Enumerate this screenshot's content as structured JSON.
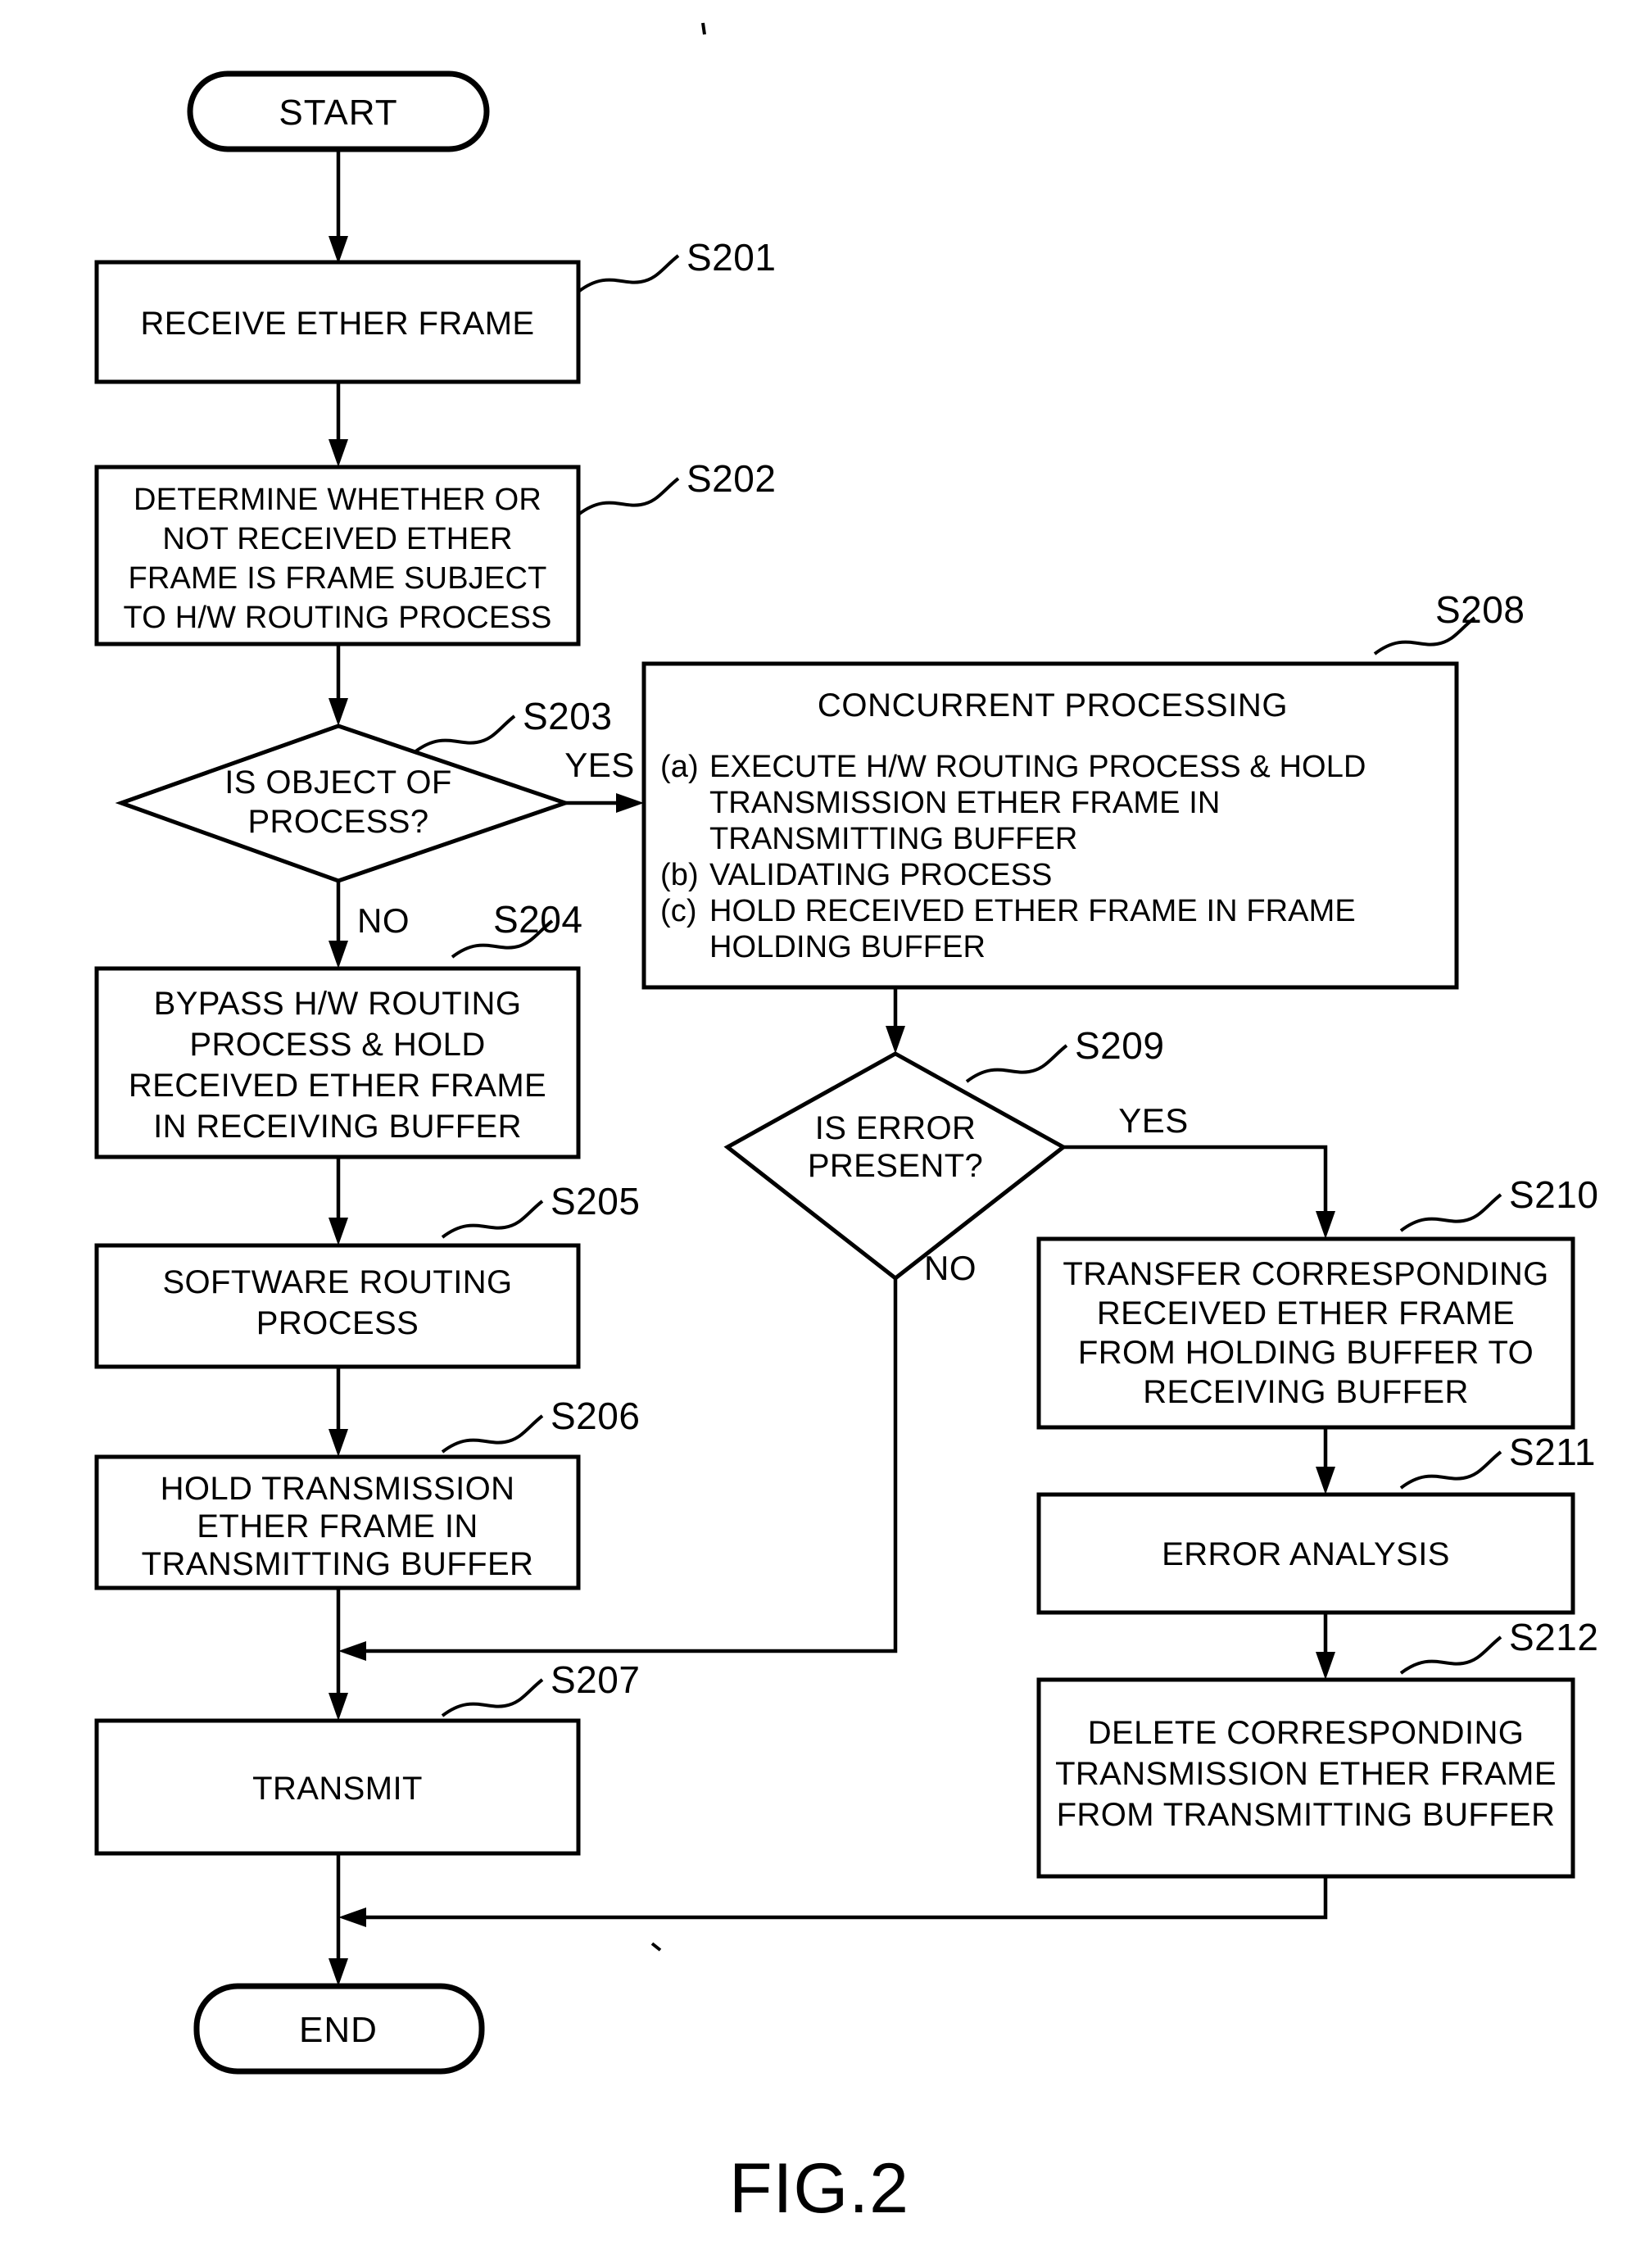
{
  "figure": {
    "caption": "FIG.2",
    "type": "flowchart"
  },
  "terminals": {
    "start": "START",
    "end": "END"
  },
  "branch_labels": {
    "s203_yes": "YES",
    "s203_no": "NO",
    "s209_yes": "YES",
    "s209_no": "NO"
  },
  "step_labels": {
    "s201": "S201",
    "s202": "S202",
    "s203": "S203",
    "s204": "S204",
    "s205": "S205",
    "s206": "S206",
    "s207": "S207",
    "s208": "S208",
    "s209": "S209",
    "s210": "S210",
    "s211": "S211",
    "s212": "S212"
  },
  "nodes": {
    "s201": {
      "id": "S201",
      "shape": "process",
      "lines": [
        "RECEIVE ETHER FRAME"
      ]
    },
    "s202": {
      "id": "S202",
      "shape": "process",
      "lines": [
        "DETERMINE WHETHER OR",
        "NOT RECEIVED ETHER",
        "FRAME IS FRAME SUBJECT",
        "TO H/W ROUTING PROCESS"
      ]
    },
    "s203": {
      "id": "S203",
      "shape": "decision",
      "lines": [
        "IS OBJECT OF",
        "PROCESS?"
      ]
    },
    "s204": {
      "id": "S204",
      "shape": "process",
      "lines": [
        "BYPASS H/W ROUTING",
        "PROCESS & HOLD",
        "RECEIVED ETHER FRAME",
        "IN RECEIVING BUFFER"
      ]
    },
    "s205": {
      "id": "S205",
      "shape": "process",
      "lines": [
        "SOFTWARE ROUTING",
        "PROCESS"
      ]
    },
    "s206": {
      "id": "S206",
      "shape": "process",
      "lines": [
        "HOLD TRANSMISSION",
        "ETHER FRAME IN",
        "TRANSMITTING BUFFER"
      ]
    },
    "s207": {
      "id": "S207",
      "shape": "process",
      "lines": [
        "TRANSMIT"
      ]
    },
    "s208": {
      "id": "S208",
      "shape": "process",
      "title": "CONCURRENT PROCESSING",
      "items": [
        {
          "marker": "(a)",
          "lines": [
            "EXECUTE H/W ROUTING PROCESS & HOLD",
            "TRANSMISSION ETHER FRAME IN",
            "TRANSMITTING BUFFER"
          ]
        },
        {
          "marker": "(b)",
          "lines": [
            "VALIDATING PROCESS"
          ]
        },
        {
          "marker": "(c)",
          "lines": [
            "HOLD RECEIVED ETHER FRAME IN FRAME",
            "HOLDING BUFFER"
          ]
        }
      ]
    },
    "s209": {
      "id": "S209",
      "shape": "decision",
      "lines": [
        "IS ERROR",
        "PRESENT?"
      ]
    },
    "s210": {
      "id": "S210",
      "shape": "process",
      "lines": [
        "TRANSFER CORRESPONDING",
        "RECEIVED ETHER FRAME",
        "FROM HOLDING BUFFER TO",
        "RECEIVING BUFFER"
      ]
    },
    "s211": {
      "id": "S211",
      "shape": "process",
      "lines": [
        "ERROR ANALYSIS"
      ]
    },
    "s212": {
      "id": "S212",
      "shape": "process",
      "lines": [
        "DELETE CORRESPONDING",
        "TRANSMISSION ETHER FRAME",
        "FROM TRANSMITTING BUFFER"
      ]
    }
  },
  "colors": {
    "stroke": "#000000",
    "fill": "#ffffff",
    "text": "#000000"
  }
}
